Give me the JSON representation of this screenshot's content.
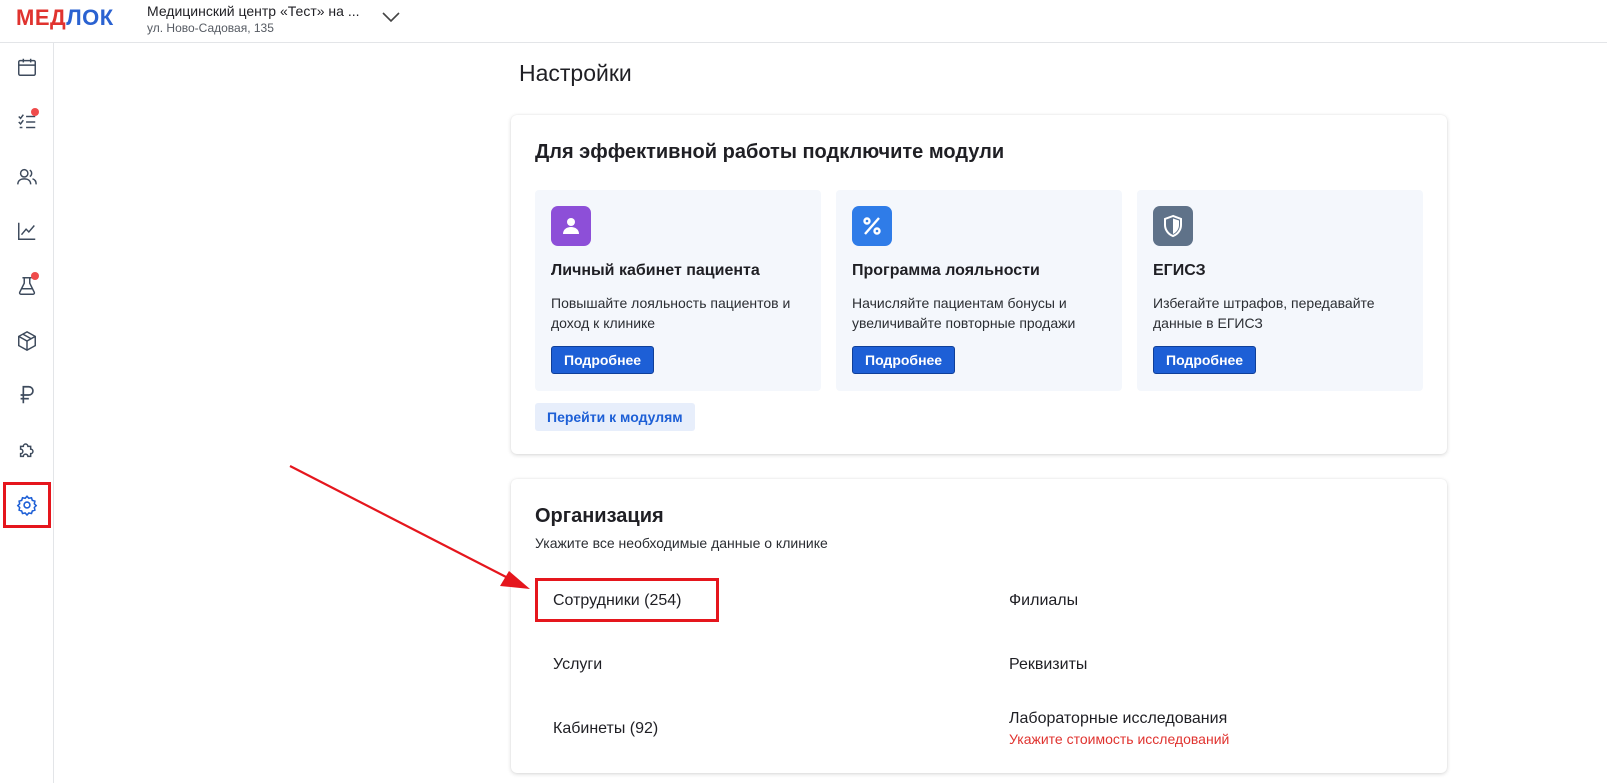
{
  "header": {
    "logo_part1": "МЕД",
    "logo_part2": "ЛОК",
    "org_name": "Медицинский центр «Тест» на ...",
    "org_address": "ул. Ново-Садовая, 135"
  },
  "sidebar": {
    "items": [
      {
        "icon": "calendar-icon"
      },
      {
        "icon": "checklist-icon",
        "badge": true
      },
      {
        "icon": "users-icon"
      },
      {
        "icon": "chart-icon"
      },
      {
        "icon": "flask-icon",
        "badge": true
      },
      {
        "icon": "box-icon"
      },
      {
        "icon": "ruble-icon"
      },
      {
        "icon": "puzzle-icon"
      },
      {
        "icon": "gear-icon",
        "active": true
      }
    ]
  },
  "main": {
    "title": "Настройки",
    "modules_card": {
      "title": "Для эффективной работы подключите модули",
      "modules": [
        {
          "title": "Личный кабинет пациента",
          "description": "Повышайте лояльность пациентов и доход к клинике",
          "button": "Подробнее",
          "icon": "person-icon",
          "color": "#8d4fd8"
        },
        {
          "title": "Программа лояльности",
          "description": "Начисляйте пациентам бонусы и увеличивайте повторные продажи",
          "button": "Подробнее",
          "icon": "percent-icon",
          "color": "#2f7ce8"
        },
        {
          "title": "ЕГИСЗ",
          "description": "Избегайте штрафов, передавайте данные в ЕГИСЗ",
          "button": "Подробнее",
          "icon": "shield-icon",
          "color": "#5f7289"
        }
      ],
      "go_to_modules": "Перейти к модулям"
    },
    "org_card": {
      "title": "Организация",
      "subtitle": "Укажите все необходимые данные о клинике",
      "links": {
        "employees": "Сотрудники (254)",
        "branches": "Филиалы",
        "services": "Услуги",
        "requisites": "Реквизиты",
        "cabinets": "Кабинеты (92)",
        "lab": "Лабораторные исследования",
        "lab_warning": "Укажите стоимость исследований"
      }
    }
  },
  "colors": {
    "accent": "#1d5fd6",
    "annotation": "#e5161d",
    "warning": "#e0332f"
  }
}
